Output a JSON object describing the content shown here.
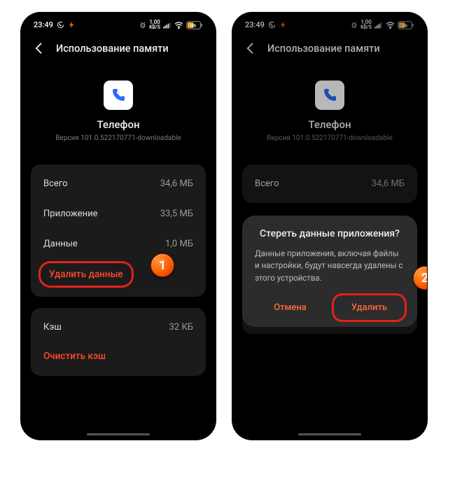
{
  "status": {
    "time": "23:49",
    "net_rate_n": "1,00",
    "net_rate_u": "KB/S",
    "battery": "46"
  },
  "header": {
    "title": "Использование памяти"
  },
  "app": {
    "name": "Телефон",
    "version": "Версия 101.0.522170771-downloadable",
    "icon": "phone-icon"
  },
  "storage": {
    "rows": [
      {
        "label": "Всего",
        "value": "34,6 МБ"
      },
      {
        "label": "Приложение",
        "value": "33,5 МБ"
      },
      {
        "label": "Данные",
        "value": "1,0 МБ"
      }
    ],
    "clear_data": "Удалить данные",
    "cache_label": "Кэш",
    "cache_value": "32 КБ",
    "clear_cache": "Очистить кэш"
  },
  "dialog": {
    "title": "Стереть данные приложения?",
    "message": "Данные приложения, включая файлы и настройки, будут навсегда удалены с этого устройства.",
    "cancel": "Отмена",
    "confirm": "Удалить"
  },
  "steps": {
    "one": "1",
    "two": "2"
  }
}
